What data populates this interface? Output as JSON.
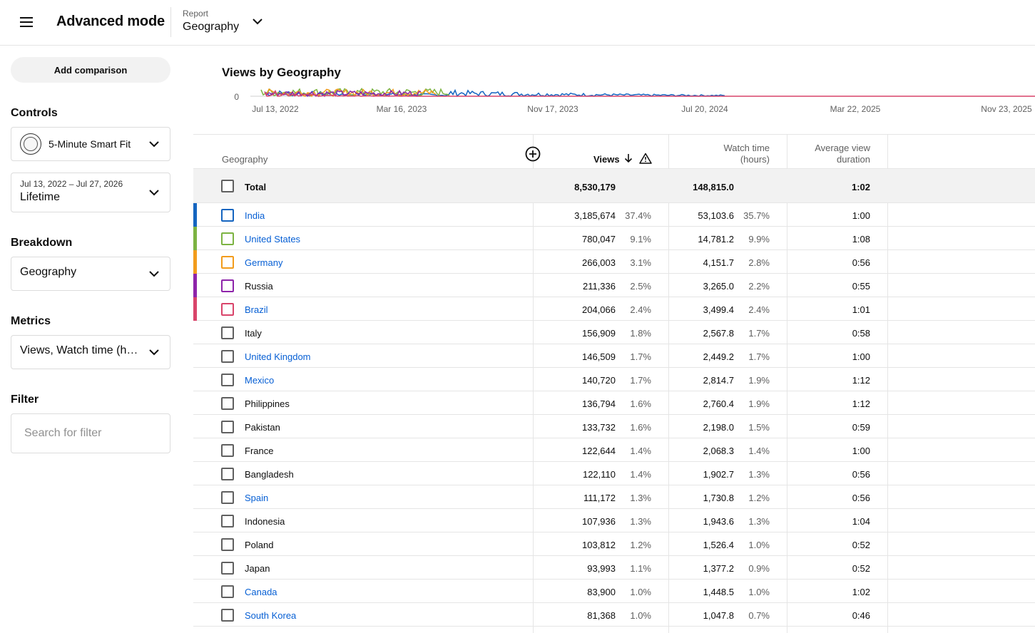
{
  "header": {
    "app_title": "Advanced mode",
    "report_caption": "Report",
    "report_value": "Geography"
  },
  "sidebar": {
    "add_comparison": "Add comparison",
    "controls_label": "Controls",
    "channel_name": "5-Minute Smart Fit",
    "date_range": "Jul 13, 2022 – Jul 27, 2026",
    "date_preset": "Lifetime",
    "breakdown_label": "Breakdown",
    "breakdown_value": "Geography",
    "metrics_label": "Metrics",
    "metrics_value": "Views, Watch time (hours)",
    "filter_label": "Filter",
    "filter_placeholder": "Search for filter"
  },
  "chart_data": {
    "type": "line",
    "title": "Views by Geography",
    "y_tick": "0",
    "x_ticks": [
      "Jul 13, 2022",
      "Mar 16, 2023",
      "Nov 17, 2023",
      "Jul 20, 2024",
      "Mar 22, 2025",
      "Nov 23, 2025"
    ],
    "series": [
      {
        "name": "India",
        "color": "#1565c0"
      },
      {
        "name": "United States",
        "color": "#7cb342"
      },
      {
        "name": "Germany",
        "color": "#f29c1c"
      },
      {
        "name": "Russia",
        "color": "#8e24aa"
      },
      {
        "name": "Brazil",
        "color": "#d9446a"
      }
    ]
  },
  "table": {
    "columns": {
      "geography": "Geography",
      "views": "Views",
      "watch_time_line1": "Watch time",
      "watch_time_line2": "(hours)",
      "avd_line1": "Average view",
      "avd_line2": "duration"
    },
    "total": {
      "name": "Total",
      "views": "8,530,179",
      "watch": "148,815.0",
      "avd": "1:02"
    },
    "rows": [
      {
        "name": "India",
        "views": "3,185,674",
        "vpct": "37.4%",
        "watch": "53,103.6",
        "wpct": "35.7%",
        "avd": "1:00"
      },
      {
        "name": "United States",
        "views": "780,047",
        "vpct": "9.1%",
        "watch": "14,781.2",
        "wpct": "9.9%",
        "avd": "1:08"
      },
      {
        "name": "Germany",
        "views": "266,003",
        "vpct": "3.1%",
        "watch": "4,151.7",
        "wpct": "2.8%",
        "avd": "0:56"
      },
      {
        "name": "Russia",
        "views": "211,336",
        "vpct": "2.5%",
        "watch": "3,265.0",
        "wpct": "2.2%",
        "avd": "0:55"
      },
      {
        "name": "Brazil",
        "views": "204,066",
        "vpct": "2.4%",
        "watch": "3,499.4",
        "wpct": "2.4%",
        "avd": "1:01"
      },
      {
        "name": "Italy",
        "views": "156,909",
        "vpct": "1.8%",
        "watch": "2,567.8",
        "wpct": "1.7%",
        "avd": "0:58"
      },
      {
        "name": "United Kingdom",
        "views": "146,509",
        "vpct": "1.7%",
        "watch": "2,449.2",
        "wpct": "1.7%",
        "avd": "1:00"
      },
      {
        "name": "Mexico",
        "views": "140,720",
        "vpct": "1.7%",
        "watch": "2,814.7",
        "wpct": "1.9%",
        "avd": "1:12"
      },
      {
        "name": "Philippines",
        "views": "136,794",
        "vpct": "1.6%",
        "watch": "2,760.4",
        "wpct": "1.9%",
        "avd": "1:12"
      },
      {
        "name": "Pakistan",
        "views": "133,732",
        "vpct": "1.6%",
        "watch": "2,198.0",
        "wpct": "1.5%",
        "avd": "0:59"
      },
      {
        "name": "France",
        "views": "122,644",
        "vpct": "1.4%",
        "watch": "2,068.3",
        "wpct": "1.4%",
        "avd": "1:00"
      },
      {
        "name": "Bangladesh",
        "views": "122,110",
        "vpct": "1.4%",
        "watch": "1,902.7",
        "wpct": "1.3%",
        "avd": "0:56"
      },
      {
        "name": "Spain",
        "views": "111,172",
        "vpct": "1.3%",
        "watch": "1,730.8",
        "wpct": "1.2%",
        "avd": "0:56"
      },
      {
        "name": "Indonesia",
        "views": "107,936",
        "vpct": "1.3%",
        "watch": "1,943.6",
        "wpct": "1.3%",
        "avd": "1:04"
      },
      {
        "name": "Poland",
        "views": "103,812",
        "vpct": "1.2%",
        "watch": "1,526.4",
        "wpct": "1.0%",
        "avd": "0:52"
      },
      {
        "name": "Japan",
        "views": "93,993",
        "vpct": "1.1%",
        "watch": "1,377.2",
        "wpct": "0.9%",
        "avd": "0:52"
      },
      {
        "name": "Canada",
        "views": "83,900",
        "vpct": "1.0%",
        "watch": "1,448.5",
        "wpct": "1.0%",
        "avd": "1:02"
      },
      {
        "name": "South Korea",
        "views": "81,368",
        "vpct": "1.0%",
        "watch": "1,047.8",
        "wpct": "0.7%",
        "avd": "0:46"
      }
    ]
  }
}
